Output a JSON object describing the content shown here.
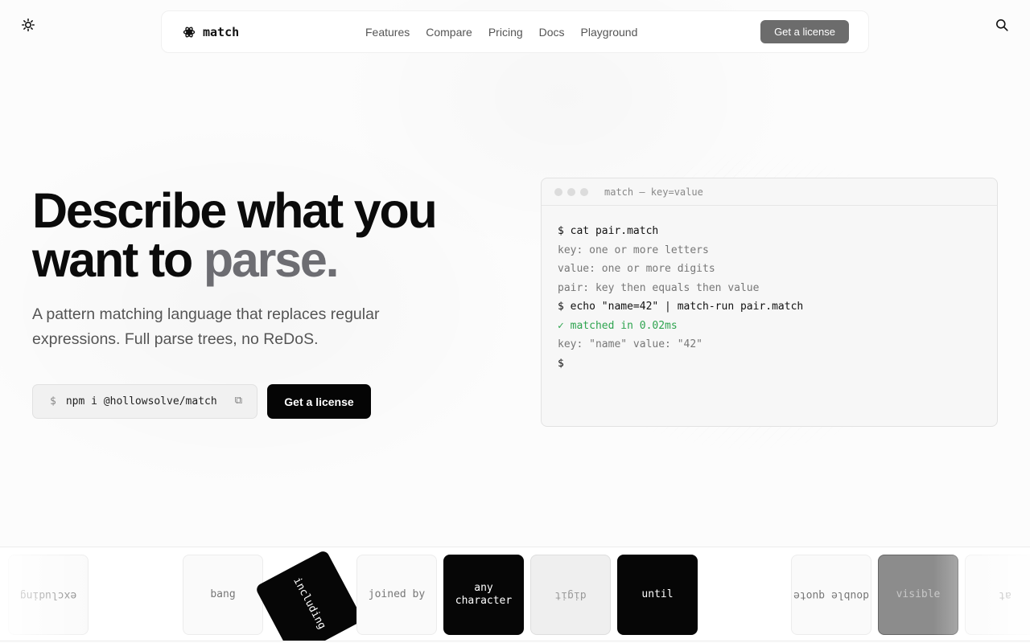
{
  "header": {
    "brand": "match",
    "nav": [
      "Features",
      "Compare",
      "Pricing",
      "Docs",
      "Playground"
    ],
    "cta_label": "Get a license",
    "theme_icon": "sun-icon",
    "search_icon": "search-icon",
    "logo_icon": "atom-icon"
  },
  "hero": {
    "title_line1": "Describe what you",
    "title_line2_a": "want to ",
    "title_line2_b": "parse.",
    "subtitle": "A pattern matching language that replaces regular expressions. Full parse trees, no ReDoS.",
    "install_prompt": "$",
    "install_command": "npm i @hollowsolve/match",
    "copy_icon": "copy-icon",
    "cta_label": "Get a license"
  },
  "terminal": {
    "title": "match — key=value",
    "lines": [
      {
        "text": "$ cat pair.match",
        "kind": "cmd"
      },
      {
        "text": "key: one or more letters",
        "kind": "out"
      },
      {
        "text": "value: one or more digits",
        "kind": "out"
      },
      {
        "text": "pair: key then equals then value",
        "kind": "out"
      },
      {
        "text": "$ echo \"name=42\" | match-run pair.match",
        "kind": "cmd"
      },
      {
        "text": "✓ matched in 0.02ms",
        "kind": "ok"
      },
      {
        "text": "key: \"name\" value: \"42\"",
        "kind": "out"
      },
      {
        "text": "$",
        "kind": "cmd"
      }
    ]
  },
  "tiles": [
    {
      "label": "excluding",
      "style": "light",
      "flipped": true
    },
    {
      "label": "bang",
      "style": "light",
      "flipped": false
    },
    {
      "label": "including",
      "style": "dark",
      "flipped": false
    },
    {
      "label": "joined by",
      "style": "light",
      "flipped": false
    },
    {
      "label": "any character",
      "style": "dark",
      "flipped": false
    },
    {
      "label": "digit",
      "style": "grey",
      "flipped": true
    },
    {
      "label": "until",
      "style": "dark",
      "flipped": false
    },
    {
      "label": "double quote",
      "style": "light",
      "flipped": true
    },
    {
      "label": "visible",
      "style": "mid",
      "flipped": false
    },
    {
      "label": "at",
      "style": "light",
      "flipped": true
    }
  ]
}
